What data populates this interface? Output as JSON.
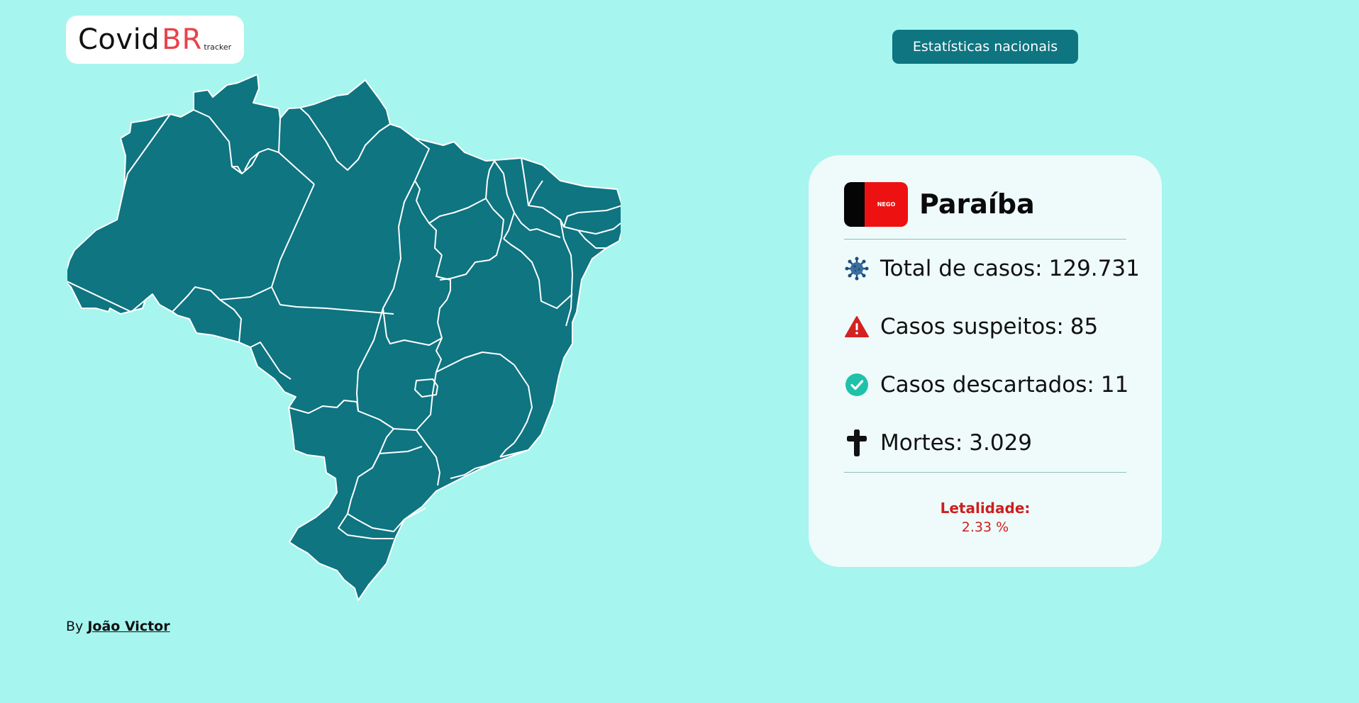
{
  "logo": {
    "covid": "Covid",
    "br": "BR",
    "tracker": "tracker"
  },
  "header": {
    "national_button": "Estatísticas nacionais"
  },
  "state_card": {
    "flag_text": "NEGO",
    "name": "Paraíba",
    "stats": [
      {
        "icon": "virus-icon",
        "label": "Total de casos:",
        "value": "129.731"
      },
      {
        "icon": "warning-icon",
        "label": "Casos suspeitos:",
        "value": "85"
      },
      {
        "icon": "check-circle-icon",
        "label": "Casos descartados:",
        "value": "11"
      },
      {
        "icon": "cross-icon",
        "label": "Mortes:",
        "value": "3.029"
      }
    ],
    "lethality_label": "Letalidade:",
    "lethality_value": "2.33 %"
  },
  "footer": {
    "by": "By",
    "author": "João Victor"
  },
  "colors": {
    "background": "#a6f5ef",
    "map_fill": "#0e7581",
    "button": "#0e7581",
    "brand_red": "#e8434a",
    "lethality_red": "#cc1f1f"
  }
}
